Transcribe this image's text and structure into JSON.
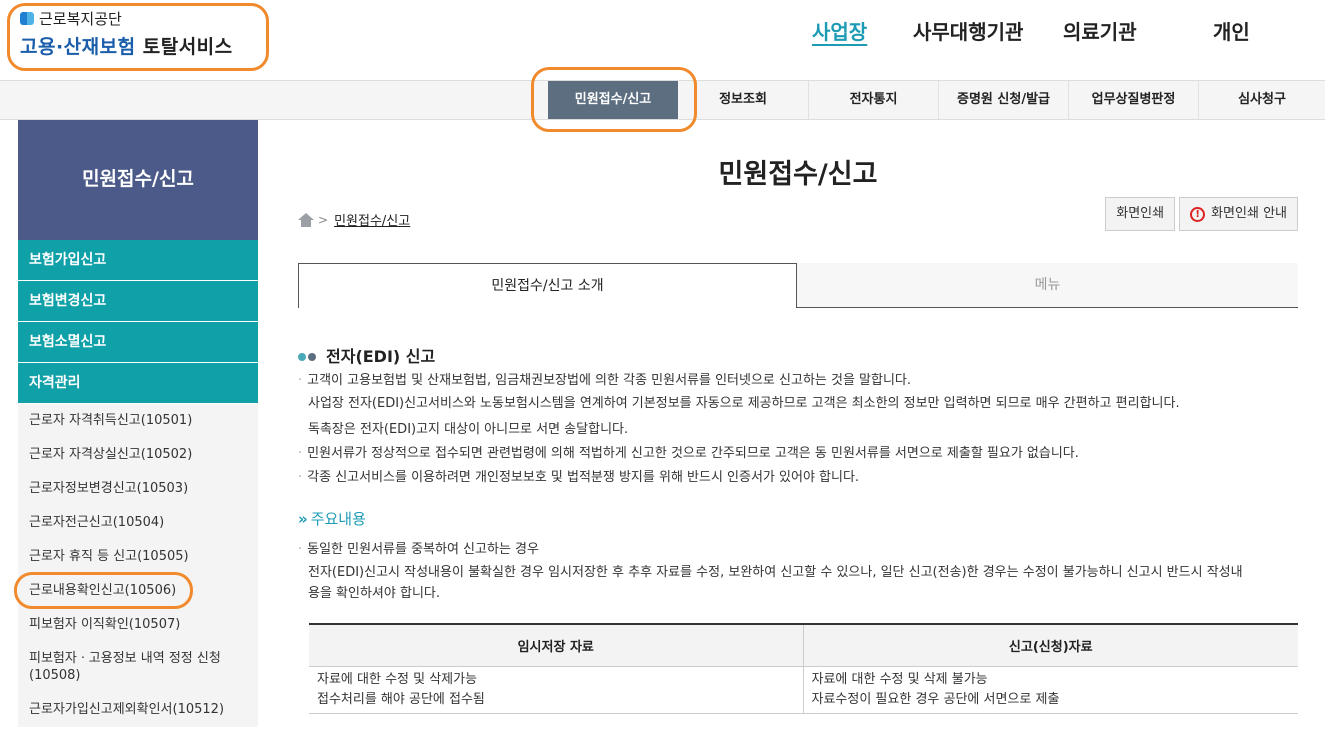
{
  "header": {
    "logo_top": "근로복지공단",
    "logo_main_blue": "고용·산재보험",
    "logo_main_dark": "토탈서비스",
    "top_nav": [
      "사업장",
      "사무대행기관",
      "의료기관",
      "개인"
    ]
  },
  "subnav": {
    "items": [
      "민원접수/신고",
      "정보조회",
      "전자통지",
      "증명원 신청/발급",
      "업무상질병판정",
      "심사청구"
    ]
  },
  "sidebar": {
    "title": "민원접수/신고",
    "sections": [
      "보험가입신고",
      "보험변경신고",
      "보험소멸신고",
      "자격관리"
    ],
    "sub_items": [
      "근로자 자격취득신고(10501)",
      "근로자 자격상실신고(10502)",
      "근로자정보변경신고(10503)",
      "근로자전근신고(10504)",
      "근로자 휴직 등 신고(10505)",
      "근로내용확인신고(10506)",
      "피보험자 이직확인(10507)",
      "피보험자ㆍ고용정보 내역 정정 신청(10508)",
      "근로자가입신고제외확인서(10512)"
    ]
  },
  "main": {
    "title": "민원접수/신고",
    "breadcrumb": "민원접수/신고",
    "print_btn": "화면인쇄",
    "print_guide_btn": "화면인쇄 안내",
    "tabs": [
      "민원접수/신고 소개",
      "메뉴"
    ],
    "section_title": "전자(EDI) 신고",
    "para": [
      "고객이 고용보험법 및 산재보험법, 임금채권보장법에 의한 각종 민원서류를 인터넷으로 신고하는 것을 말합니다.",
      "사업장 전자(EDI)신고서비스와 노동보험시스템을 연계하여 기본정보를 자동으로 제공하므로 고객은 최소한의 정보만 입력하면 되므로 매우 간편하고 편리합니다.",
      "독촉장은 전자(EDI)고지 대상이 아니므로 서면 송달합니다.",
      "민원서류가 정상적으로 접수되면 관련법령에 의해 적법하게 신고한 것으로 간주되므로 고객은 동 민원서류를 서면으로 제출할 필요가 없습니다.",
      "각종 신고서비스를 이용하려면 개인정보보호 및 법적분쟁 방지를 위해 반드시 인증서가 있어야 합니다."
    ],
    "sub_title": "주요내용",
    "sub_para": [
      "동일한 민원서류를 중복하여 신고하는 경우",
      "전자(EDI)신고시 작성내용이 불확실한 경우 임시저장한 후 추후 자료를 수정, 보완하여 신고할 수 있으나, 일단 신고(전송)한 경우는 수정이 불가능하니 신고시 반드시 작성내",
      "용을 확인하셔야 합니다."
    ],
    "table": {
      "headers": [
        "임시저장 자료",
        "신고(신청)자료"
      ],
      "rows": [
        [
          "자료에 대한 수정 및 삭제가능",
          "자료에 대한 수정 및 삭제 불가능"
        ],
        [
          "접수처리를 해야 공단에 접수됨",
          "자료수정이 필요한 경우 공단에 서면으로 제출"
        ]
      ]
    }
  },
  "colors": {
    "accent": "#1d9bb5",
    "sidebar_title_bg": "#4b5a88",
    "sidebar_section_bg": "#0fa0a8",
    "subnav_active_bg": "#5d6e80",
    "highlight": "#f08a2c"
  },
  "icons": [
    "home-icon",
    "warning-icon",
    "double-chevron-icon",
    "logo-icon"
  ]
}
